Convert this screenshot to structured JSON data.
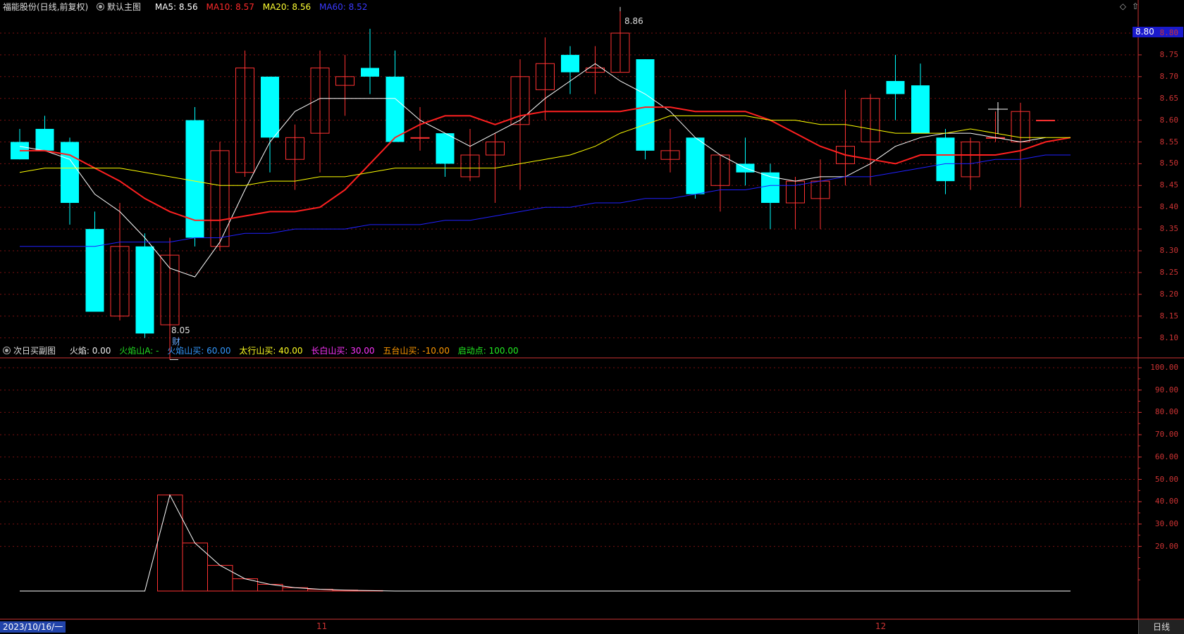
{
  "main_header": {
    "stock": "福能股份(日线,前复权)",
    "panel": "默认主图",
    "ma5": "MA5: 8.56",
    "ma10": "MA10: 8.57",
    "ma20": "MA20: 8.56",
    "ma60": "MA60: 8.52"
  },
  "sub_header": {
    "panel": "次日买副图",
    "huoyan": "火焰: 0.00",
    "hysA": "火焰山A: -",
    "hysBuy": "火焰山买: 60.00",
    "taihang": "太行山买: 40.00",
    "changbai": "长白山买: 30.00",
    "wutai": "五台山买: -10.00",
    "qidong": "启动点: 100.00"
  },
  "controls": {
    "diamond": "◇",
    "up": "⇧"
  },
  "current_price": "8.80",
  "annotations": {
    "high": "8.86",
    "low": "8.05",
    "cai": "财"
  },
  "x_axis": {
    "start": "2023/10/16/一",
    "m11": "11",
    "m12": "12",
    "period": "日线"
  },
  "colors": {
    "up": "#ff3232",
    "down": "#00ffff",
    "ma5": "#ffffff",
    "ma10": "#ff2020",
    "ma20": "#ffff00",
    "ma60": "#2020ff",
    "grid": "#7a1010",
    "axis": "#cc3333",
    "hysA": "#00dd00",
    "hysBuy": "#3399ff",
    "taihang": "#ffff00",
    "changbai": "#ff33ff",
    "wutai": "#ff9900",
    "qidong": "#00ff00"
  },
  "chart_data": [
    {
      "type": "candlestick",
      "title": "福能股份(日线,前复权)",
      "y_ticks": [
        "8.80",
        "8.75",
        "8.70",
        "8.65",
        "8.60",
        "8.55",
        "8.50",
        "8.45",
        "8.40",
        "8.35",
        "8.30",
        "8.25",
        "8.20",
        "8.15",
        "8.10"
      ],
      "ylim": [
        8.05,
        8.81
      ],
      "candles": [
        {
          "o": 8.55,
          "h": 8.58,
          "l": 8.51,
          "c": 8.51
        },
        {
          "o": 8.58,
          "h": 8.61,
          "l": 8.53,
          "c": 8.53
        },
        {
          "o": 8.55,
          "h": 8.56,
          "l": 8.36,
          "c": 8.41
        },
        {
          "o": 8.35,
          "h": 8.39,
          "l": 8.16,
          "c": 8.16
        },
        {
          "o": 8.15,
          "h": 8.41,
          "l": 8.14,
          "c": 8.31
        },
        {
          "o": 8.31,
          "h": 8.34,
          "l": 8.1,
          "c": 8.11
        },
        {
          "o": 8.13,
          "h": 8.33,
          "l": 8.05,
          "c": 8.29
        },
        {
          "o": 8.6,
          "h": 8.63,
          "l": 8.31,
          "c": 8.33
        },
        {
          "o": 8.31,
          "h": 8.55,
          "l": 8.3,
          "c": 8.53
        },
        {
          "o": 8.48,
          "h": 8.76,
          "l": 8.47,
          "c": 8.72
        },
        {
          "o": 8.7,
          "h": 8.7,
          "l": 8.48,
          "c": 8.56
        },
        {
          "o": 8.51,
          "h": 8.59,
          "l": 8.44,
          "c": 8.56
        },
        {
          "o": 8.57,
          "h": 8.76,
          "l": 8.48,
          "c": 8.72
        },
        {
          "o": 8.68,
          "h": 8.75,
          "l": 8.61,
          "c": 8.7
        },
        {
          "o": 8.72,
          "h": 8.81,
          "l": 8.66,
          "c": 8.7
        },
        {
          "o": 8.7,
          "h": 8.76,
          "l": 8.55,
          "c": 8.55
        },
        {
          "o": 8.56,
          "h": 8.63,
          "l": 8.53,
          "c": 8.56
        },
        {
          "o": 8.57,
          "h": 8.57,
          "l": 8.47,
          "c": 8.5
        },
        {
          "o": 8.47,
          "h": 8.58,
          "l": 8.46,
          "c": 8.52
        },
        {
          "o": 8.52,
          "h": 8.57,
          "l": 8.41,
          "c": 8.55
        },
        {
          "o": 8.59,
          "h": 8.74,
          "l": 8.44,
          "c": 8.7
        },
        {
          "o": 8.67,
          "h": 8.79,
          "l": 8.6,
          "c": 8.73
        },
        {
          "o": 8.75,
          "h": 8.77,
          "l": 8.66,
          "c": 8.71
        },
        {
          "o": 8.71,
          "h": 8.77,
          "l": 8.66,
          "c": 8.72
        },
        {
          "o": 8.71,
          "h": 8.86,
          "l": 8.71,
          "c": 8.8
        },
        {
          "o": 8.74,
          "h": 8.74,
          "l": 8.51,
          "c": 8.53
        },
        {
          "o": 8.51,
          "h": 8.58,
          "l": 8.48,
          "c": 8.53
        },
        {
          "o": 8.56,
          "h": 8.56,
          "l": 8.42,
          "c": 8.43
        },
        {
          "o": 8.45,
          "h": 8.52,
          "l": 8.39,
          "c": 8.52
        },
        {
          "o": 8.5,
          "h": 8.56,
          "l": 8.45,
          "c": 8.48
        },
        {
          "o": 8.48,
          "h": 8.5,
          "l": 8.35,
          "c": 8.41
        },
        {
          "o": 8.41,
          "h": 8.47,
          "l": 8.35,
          "c": 8.46
        },
        {
          "o": 8.42,
          "h": 8.51,
          "l": 8.35,
          "c": 8.46
        },
        {
          "o": 8.5,
          "h": 8.67,
          "l": 8.45,
          "c": 8.54
        },
        {
          "o": 8.55,
          "h": 8.66,
          "l": 8.45,
          "c": 8.65
        },
        {
          "o": 8.69,
          "h": 8.75,
          "l": 8.6,
          "c": 8.66
        },
        {
          "o": 8.68,
          "h": 8.73,
          "l": 8.57,
          "c": 8.57
        },
        {
          "o": 8.56,
          "h": 8.58,
          "l": 8.43,
          "c": 8.46
        },
        {
          "o": 8.47,
          "h": 8.56,
          "l": 8.44,
          "c": 8.55
        },
        {
          "o": 8.56,
          "h": 8.62,
          "l": 8.55,
          "c": 8.56
        },
        {
          "o": 8.55,
          "h": 8.64,
          "l": 8.4,
          "c": 8.62
        },
        {
          "o": 8.6,
          "h": 8.6,
          "l": 8.6,
          "c": 8.6
        }
      ],
      "series": [
        {
          "name": "MA5",
          "values": [
            8.54,
            8.53,
            8.51,
            8.43,
            8.39,
            8.33,
            8.26,
            8.24,
            8.32,
            8.44,
            8.55,
            8.62,
            8.65,
            8.65,
            8.65,
            8.65,
            8.6,
            8.57,
            8.54,
            8.57,
            8.6,
            8.65,
            8.69,
            8.73,
            8.69,
            8.66,
            8.62,
            8.56,
            8.52,
            8.49,
            8.47,
            8.46,
            8.47,
            8.47,
            8.5,
            8.54,
            8.56,
            8.57,
            8.57,
            8.56,
            8.55,
            8.56
          ]
        },
        {
          "name": "MA10",
          "values": [
            8.53,
            8.53,
            8.52,
            8.49,
            8.46,
            8.42,
            8.39,
            8.37,
            8.37,
            8.38,
            8.39,
            8.39,
            8.4,
            8.44,
            8.5,
            8.56,
            8.59,
            8.61,
            8.61,
            8.59,
            8.61,
            8.62,
            8.62,
            8.62,
            8.62,
            8.63,
            8.63,
            8.62,
            8.62,
            8.62,
            8.6,
            8.57,
            8.54,
            8.52,
            8.51,
            8.5,
            8.52,
            8.52,
            8.52,
            8.52,
            8.53,
            8.55,
            8.56
          ]
        },
        {
          "name": "MA20",
          "values": [
            8.48,
            8.49,
            8.49,
            8.49,
            8.49,
            8.48,
            8.47,
            8.46,
            8.45,
            8.45,
            8.46,
            8.46,
            8.47,
            8.47,
            8.48,
            8.49,
            8.49,
            8.49,
            8.49,
            8.49,
            8.5,
            8.51,
            8.52,
            8.54,
            8.57,
            8.59,
            8.61,
            8.61,
            8.61,
            8.61,
            8.6,
            8.6,
            8.59,
            8.59,
            8.58,
            8.57,
            8.57,
            8.57,
            8.58,
            8.57,
            8.56,
            8.56,
            8.56
          ]
        },
        {
          "name": "MA60",
          "values": [
            8.31,
            8.31,
            8.31,
            8.31,
            8.32,
            8.32,
            8.32,
            8.33,
            8.33,
            8.34,
            8.34,
            8.35,
            8.35,
            8.35,
            8.36,
            8.36,
            8.36,
            8.37,
            8.37,
            8.38,
            8.39,
            8.4,
            8.4,
            8.41,
            8.41,
            8.42,
            8.42,
            8.43,
            8.44,
            8.44,
            8.45,
            8.45,
            8.46,
            8.47,
            8.47,
            8.48,
            8.49,
            8.5,
            8.5,
            8.51,
            8.51,
            8.52,
            8.52
          ]
        }
      ]
    },
    {
      "type": "bar",
      "title": "次日买副图",
      "y_ticks": [
        "100.00",
        "90.00",
        "80.00",
        "70.00",
        "60.00",
        "50.00",
        "40.00",
        "30.00",
        "20.00"
      ],
      "ylim": [
        0,
        105
      ],
      "boxes": [
        {
          "start": 5,
          "end": 6,
          "value": 43.0
        },
        {
          "start": 6,
          "end": 7,
          "value": 21.5
        },
        {
          "start": 7,
          "end": 8,
          "value": 11.5
        },
        {
          "start": 8,
          "end": 9,
          "value": 5.5
        },
        {
          "start": 9,
          "end": 10,
          "value": 3.0
        },
        {
          "start": 10,
          "end": 11,
          "value": 1.5
        },
        {
          "start": 11,
          "end": 12,
          "value": 0.8
        },
        {
          "start": 12,
          "end": 13,
          "value": 0.4
        },
        {
          "start": 13,
          "end": 14,
          "value": 0.2
        }
      ],
      "line": [
        0,
        0,
        0,
        0,
        0,
        0,
        43,
        21.5,
        11.5,
        5.5,
        3,
        1.5,
        0.8,
        0.4,
        0.2,
        0,
        0,
        0,
        0,
        0,
        0,
        0,
        0,
        0,
        0,
        0,
        0,
        0,
        0,
        0,
        0,
        0,
        0,
        0,
        0,
        0,
        0,
        0,
        0,
        0,
        0,
        0,
        0
      ]
    }
  ]
}
